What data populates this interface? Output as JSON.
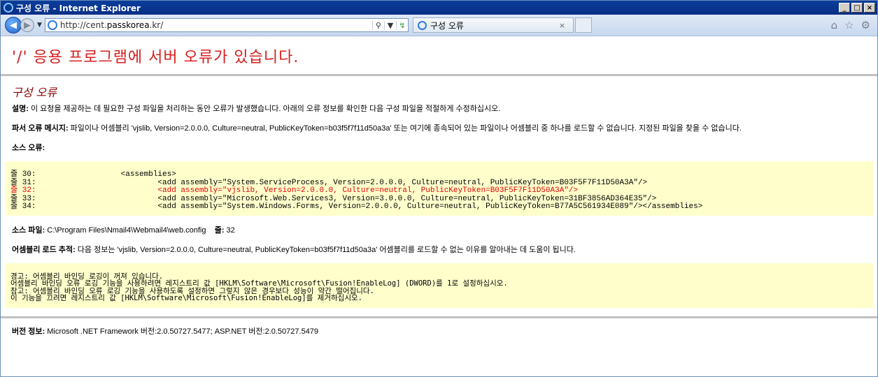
{
  "window": {
    "title": "구성 오류 - Internet Explorer",
    "btn_min": "_",
    "btn_max": "□",
    "btn_close": "×"
  },
  "nav": {
    "url_prefix": "http://cent.",
    "url_domain": "passkorea",
    "url_suffix": ".kr/",
    "search_glyph": "⚲",
    "tab_title": "구성 오류",
    "tab_close": "×"
  },
  "page": {
    "main_heading": "'/' 응용 프로그램에 서버 오류가 있습니다.",
    "sub_heading": "구성 오류",
    "desc_label": "설명:",
    "desc_text": " 이 요청을 제공하는 데 필요한 구성 파일을 처리하는 동안 오류가 발생했습니다. 아래의 오류 정보를 확인한 다음 구성 파일을 적절하게 수정하십시오.",
    "parser_label": "파서 오류 메시지:",
    "parser_text": " 파일이나 어셈블리 'vjslib, Version=2.0.0.0, Culture=neutral, PublicKeyToken=b03f5f7f11d50a3a' 또는 여기에 종속되어 있는 파일이나 어셈블리 중 하나를 로드할 수 없습니다. 지정된 파일을 찾을 수 없습니다.",
    "source_error_label": "소스 오류:",
    "code_lines": [
      {
        "num": "줄 30:",
        "text": "                <assemblies>"
      },
      {
        "num": "줄 31:",
        "text": "                        <add assembly=\"System.ServiceProcess, Version=2.0.0.0, Culture=neutral, PublicKeyToken=B03F5F7F11D50A3A\"/>"
      },
      {
        "num": "줄 32:",
        "text": "                        <add assembly=\"vjslib, Version=2.0.0.0, Culture=neutral, PublicKeyToken=B03F5F7F11D50A3A\"/>"
      },
      {
        "num": "줄 33:",
        "text": "                        <add assembly=\"Microsoft.Web.Services3, Version=3.0.0.0, Culture=neutral, PublicKeyToken=31BF3856AD364E35\"/>"
      },
      {
        "num": "줄 34:",
        "text": "                        <add assembly=\"System.Windows.Forms, Version=2.0.0.0, Culture=neutral, PublicKeyToken=B77A5C561934E089\"/></assemblies>"
      }
    ],
    "source_file_label": "소스 파일:",
    "source_file_value": " C:\\Program Files\\Nmail4\\Webmail4\\web.config",
    "line_label": "줄:",
    "line_value": " 32",
    "assembly_trace_label": "어셈블리 로드 추적:",
    "assembly_trace_text": " 다음 정보는 'vjslib, Version=2.0.0.0, Culture=neutral, PublicKeyToken=b03f5f7f11d50a3a' 어셈블리를 로드할 수 없는 이유를 알아내는 데 도움이 됩니다.",
    "warning_lines": [
      "경고: 어셈블리 바인딩 로깅이 꺼져 있습니다.",
      "어셈블리 바인딩 오류 로깅 기능을 사용하려면 레지스트리 값 [HKLM\\Software\\Microsoft\\Fusion!EnableLog] (DWORD)를 1로 설정하십시오.",
      "참고: 어셈블리 바인딩 오류 로깅 기능을 사용하도록 설정하면 그렇지 않은 경우보다 성능이 약간 떨어집니다.",
      "이 기능을 끄려면 레지스트리 값 [HKLM\\Software\\Microsoft\\Fusion!EnableLog]를 제거하십시오."
    ],
    "version_label": "버전 정보:",
    "version_text": " Microsoft .NET Framework 버전:2.0.50727.5477; ASP.NET 버전:2.0.50727.5479"
  },
  "colors": {
    "heading_red": "#d81e1e",
    "subheading": "#8b0000",
    "code_bg": "#ffffcc",
    "error_line": "#e00000"
  }
}
